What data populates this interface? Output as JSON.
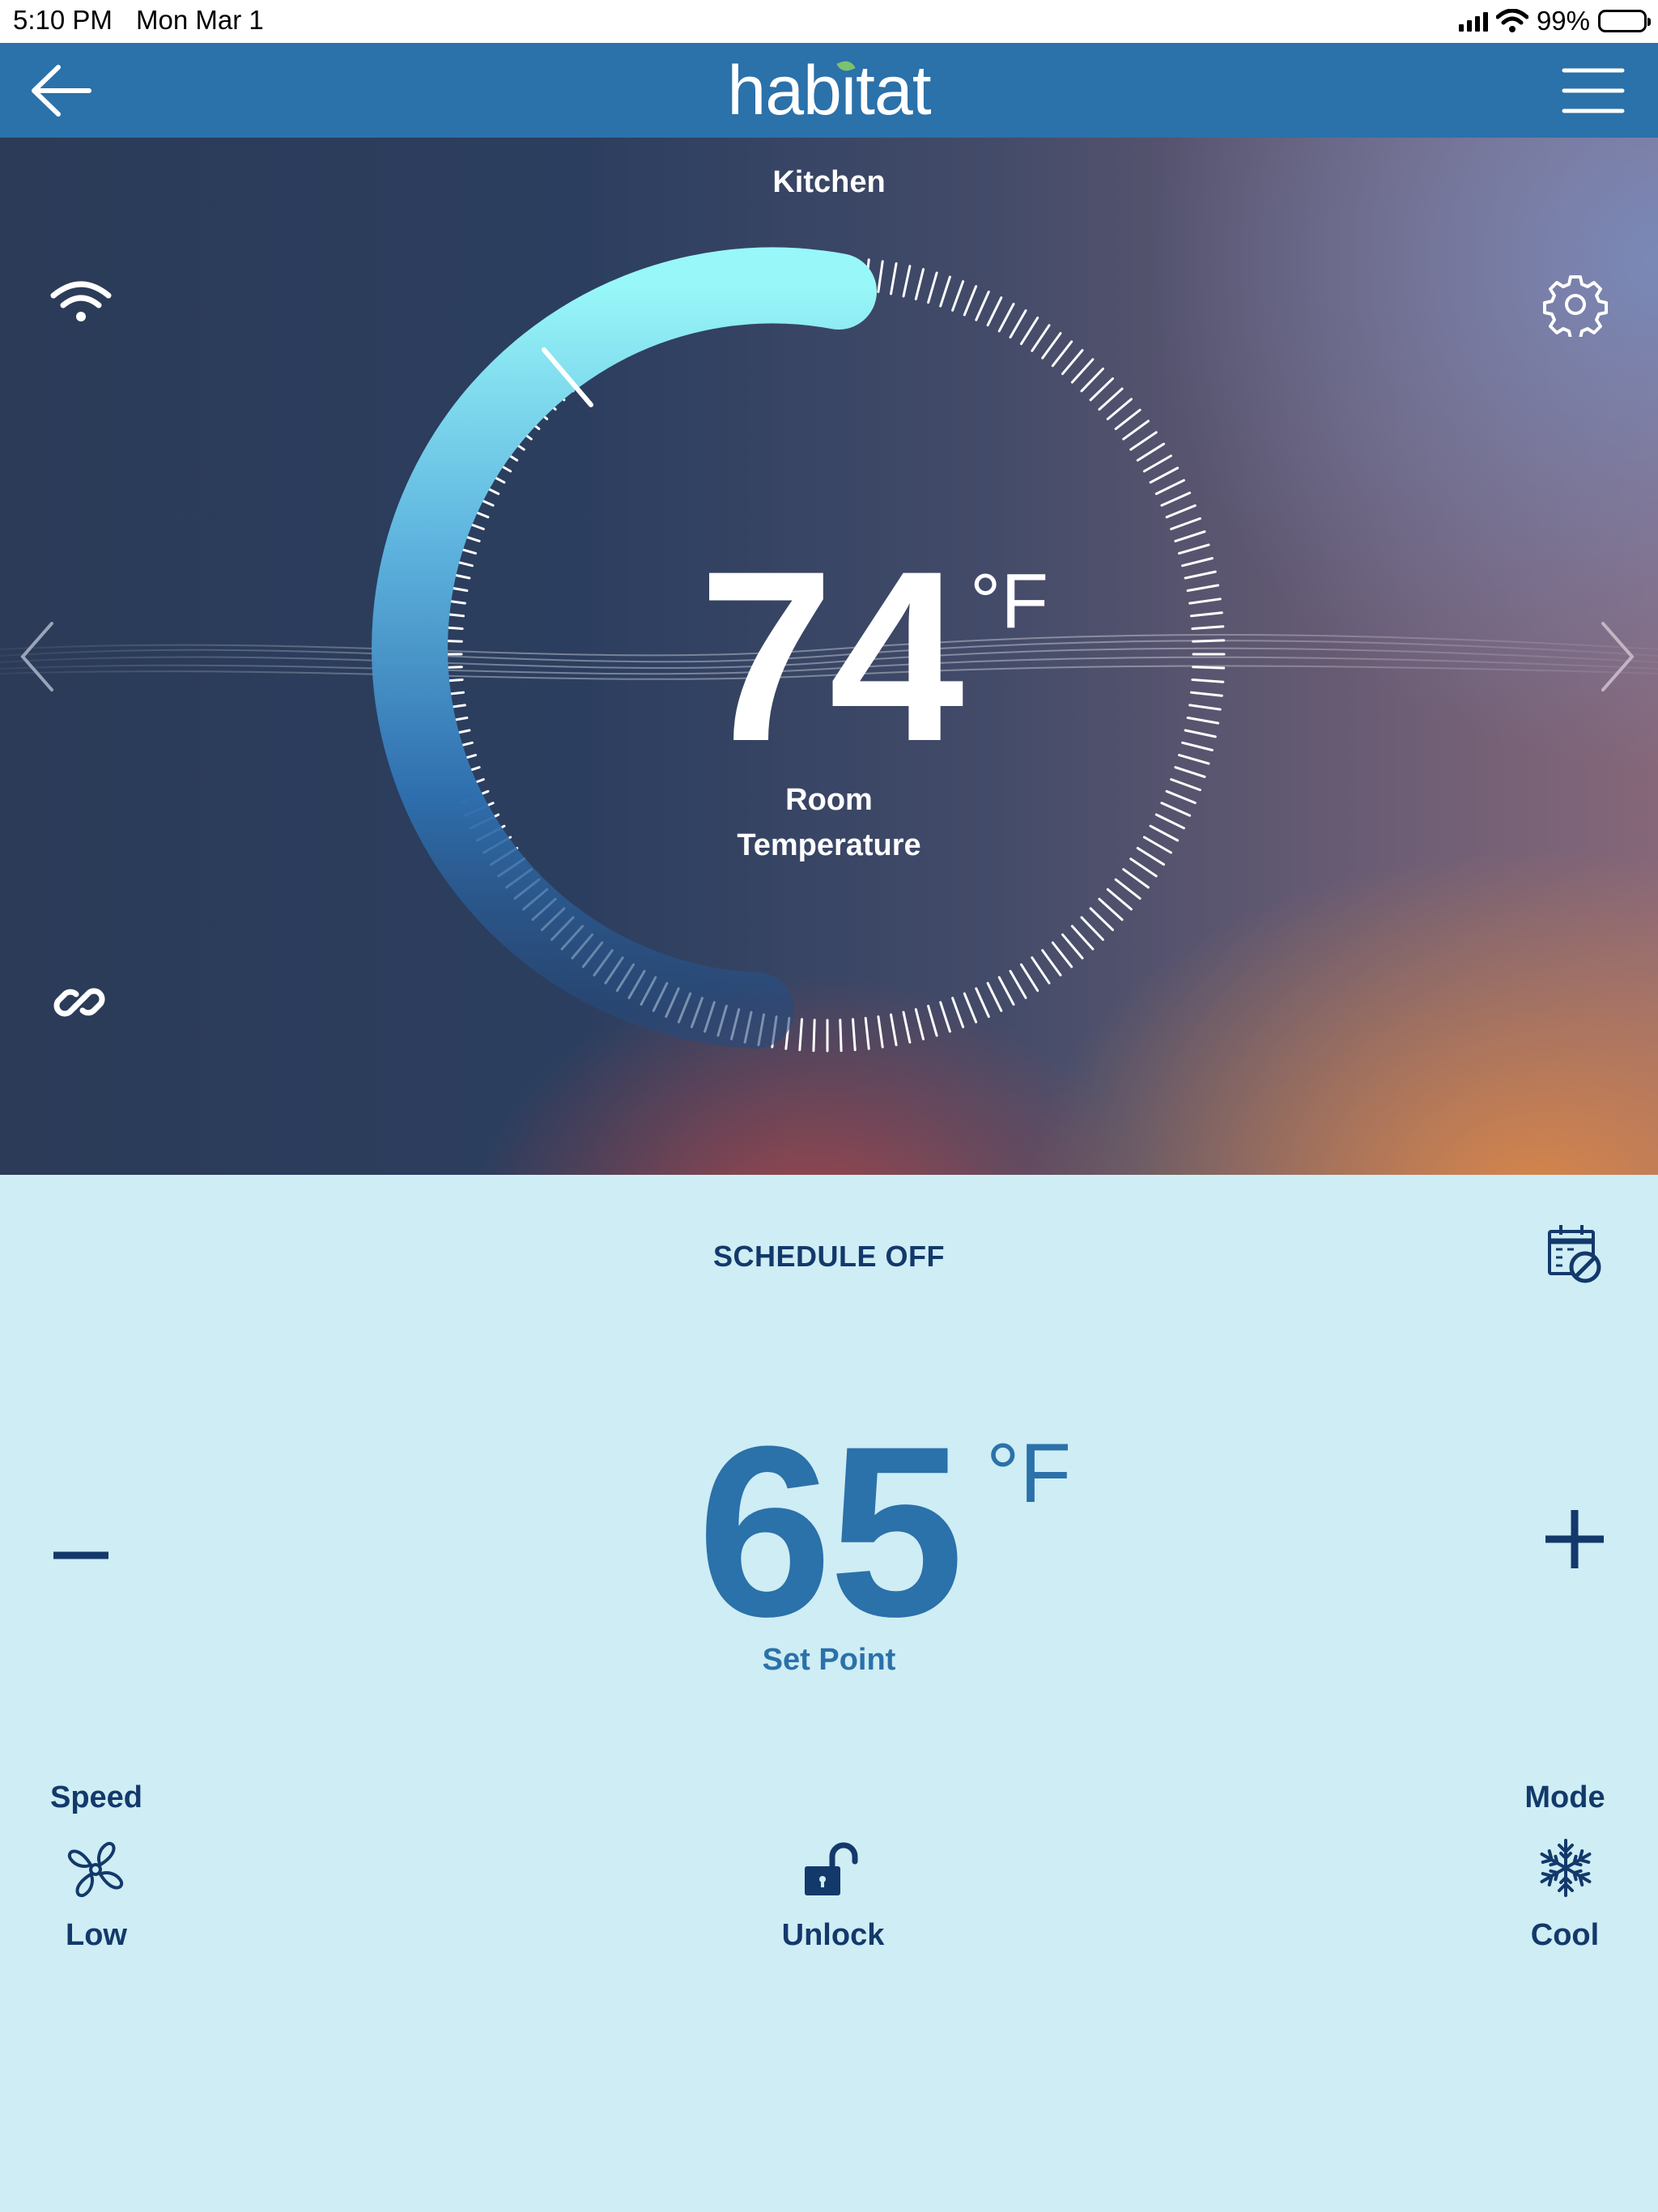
{
  "status_bar": {
    "time": "5:10 PM",
    "date": "Mon Mar 1",
    "battery": "99%"
  },
  "nav": {
    "logo": "habitat",
    "back_icon": "arrow-left-icon",
    "menu_icon": "hamburger-menu-icon"
  },
  "hero": {
    "room": "Kitchen",
    "room_temperature": "74",
    "unit": "°F",
    "label": "Room Temperature",
    "icons": [
      "wifi-icon",
      "gear-icon",
      "link-icon",
      "chevron-left-icon",
      "chevron-right-icon"
    ]
  },
  "panel": {
    "schedule": "SCHEDULE OFF",
    "calendar_icon": "calendar-off-icon",
    "setpoint": "65",
    "setpoint_unit": "°F",
    "setpoint_label": "Set Point",
    "minus_label": "−",
    "plus_label": "+",
    "speed": {
      "title": "Speed",
      "value": "Low",
      "icon": "fan-icon"
    },
    "lock": {
      "value": "Unlock",
      "icon": "unlock-icon"
    },
    "mode": {
      "title": "Mode",
      "value": "Cool",
      "icon": "snowflake-icon"
    }
  },
  "colors": {
    "nav": "#2b71aa",
    "panel": "#ceedf4",
    "text_dark": "#13396b",
    "accent": "#2b71aa",
    "arc_light": "#98f7f8"
  }
}
